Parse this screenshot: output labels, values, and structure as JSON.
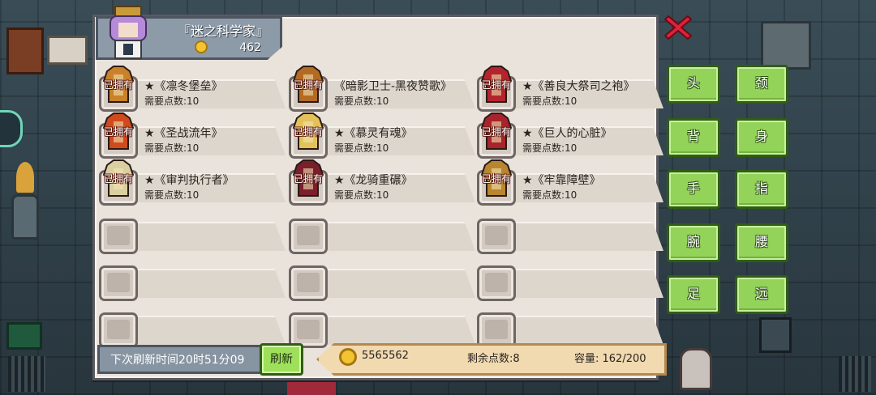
{
  "player": {
    "name": "『迷之科学家』",
    "coins": "462"
  },
  "grid": {
    "owned_label": "已拥有",
    "items": [
      {
        "name": "★《凛冬堡垒》",
        "cost": "需要点数:10",
        "owned": true,
        "color": "#c9812a"
      },
      {
        "name": "《暗影卫士-黑夜赞歌》",
        "cost": "需要点数:10",
        "owned": true,
        "color": "#b36a22"
      },
      {
        "name": "★《善良大祭司之袍》",
        "cost": "需要点数:10",
        "owned": true,
        "color": "#b3242e"
      },
      {
        "name": "★《圣战流年》",
        "cost": "需要点数:10",
        "owned": true,
        "color": "#d04a1e"
      },
      {
        "name": "★《慕灵有魂》",
        "cost": "需要点数:10",
        "owned": true,
        "color": "#e3c25a"
      },
      {
        "name": "★《巨人的心脏》",
        "cost": "需要点数:10",
        "owned": true,
        "color": "#a8232b"
      },
      {
        "name": "★《审判执行者》",
        "cost": "需要点数:10",
        "owned": true,
        "color": "#d9cfa0"
      },
      {
        "name": "★《龙骑重碾》",
        "cost": "需要点数:10",
        "owned": true,
        "color": "#7a1f2c"
      },
      {
        "name": "★《牢靠障壁》",
        "cost": "需要点数:10",
        "owned": true,
        "color": "#b8862f"
      }
    ]
  },
  "footer": {
    "refresh_timer": "下次刷新时间20时51分09",
    "refresh_button": "刷新",
    "gold": "5565562",
    "points": "剩余点数:8",
    "capacity": "容量:  162/200"
  },
  "side": {
    "slots": [
      "头",
      "颈",
      "背",
      "身",
      "手",
      "指",
      "腕",
      "腰",
      "足",
      "远"
    ]
  },
  "colors": {
    "panel": "#e9e3dc",
    "button_green": "#94d35a",
    "close_red": "#e0213a"
  },
  "icons": {
    "close": "close-x-icon",
    "coin": "gold-coin-icon"
  }
}
